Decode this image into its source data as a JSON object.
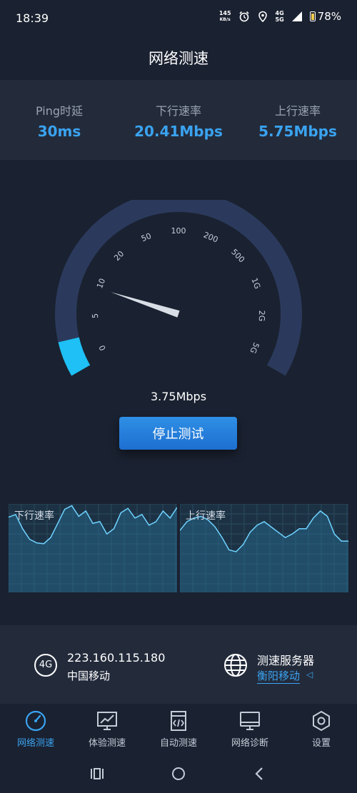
{
  "status": {
    "time": "18:39",
    "net_speed_value": "145",
    "net_speed_unit": "KB/s",
    "network": "4G 5G",
    "battery": "78%"
  },
  "title": "网络测速",
  "metrics": [
    {
      "label": "Ping时延",
      "value": "30ms"
    },
    {
      "label": "下行速率",
      "value": "20.41Mbps"
    },
    {
      "label": "上行速率",
      "value": "5.75Mbps"
    }
  ],
  "gauge": {
    "scale_labels": [
      "0",
      "5",
      "10",
      "20",
      "50",
      "100",
      "200",
      "500",
      "1G",
      "2G",
      "5G"
    ],
    "current_speed": "3.75Mbps",
    "fill_fraction": 0.07
  },
  "stop_button": "停止测试",
  "charts": {
    "download_label": "下行速率",
    "upload_label": "上行速率"
  },
  "network_info": {
    "type_badge": "4G",
    "ip": "223.160.115.180",
    "carrier": "中国移动",
    "server_title": "测速服务器",
    "server_name": "衡阳移动"
  },
  "tabs": [
    {
      "label": "网络测速",
      "icon": "speedometer-icon",
      "active": true
    },
    {
      "label": "体验测速",
      "icon": "chart-monitor-icon",
      "active": false
    },
    {
      "label": "自动测速",
      "icon": "code-file-icon",
      "active": false
    },
    {
      "label": "网络诊断",
      "icon": "monitor-icon",
      "active": false
    },
    {
      "label": "设置",
      "icon": "settings-hexagon-icon",
      "active": false
    }
  ],
  "colors": {
    "background": "#1a2130",
    "panel": "#232b3b",
    "accent": "#3aa3f0",
    "gauge_track": "#2b3a5c",
    "gauge_fill": "#1ec0f5",
    "chart_bg": "#1c3244",
    "chart_line": "#6fd3ff"
  }
}
